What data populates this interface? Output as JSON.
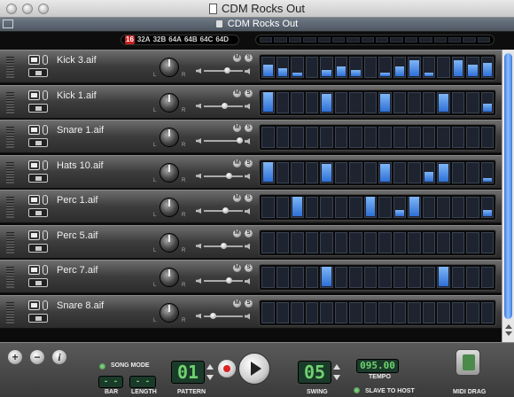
{
  "window": {
    "title": "CDM Rocks Out"
  },
  "toolbar": {
    "subtitle": "CDM Rocks Out"
  },
  "patterns": {
    "items": [
      "16",
      "32A",
      "32B",
      "64A",
      "64B",
      "64C",
      "64D"
    ],
    "active_index": 0
  },
  "tracks": [
    {
      "name": "Kick 3.aif",
      "volume": 0.62,
      "steps": [
        0.6,
        0.4,
        0.2,
        0,
        0.3,
        0.5,
        0.3,
        0,
        0.2,
        0.5,
        0.8,
        0.2,
        0,
        0.8,
        0.6,
        0.7
      ]
    },
    {
      "name": "Kick 1.aif",
      "volume": 0.54,
      "steps": [
        1,
        0,
        0,
        0,
        0.9,
        0,
        0,
        0,
        0.9,
        0,
        0,
        0,
        0.9,
        0,
        0,
        0.4
      ]
    },
    {
      "name": "Snare 1.aif",
      "volume": 1.0,
      "steps": [
        0,
        0,
        0,
        0,
        0,
        0,
        0,
        0,
        0,
        0,
        0,
        0,
        0,
        0,
        0,
        0
      ]
    },
    {
      "name": "Hats 10.aif",
      "volume": 0.68,
      "steps": [
        1,
        0,
        0,
        0,
        0.9,
        0,
        0,
        0,
        0.9,
        0,
        0,
        0.5,
        0.9,
        0,
        0,
        0.2
      ]
    },
    {
      "name": "Perc 1.aif",
      "volume": 0.58,
      "steps": [
        0,
        0,
        1,
        0,
        0,
        0,
        0,
        1,
        0,
        0.3,
        1,
        0,
        0,
        0,
        0,
        0.3
      ]
    },
    {
      "name": "Perc 5.aif",
      "volume": 0.5,
      "steps": [
        0,
        0,
        0,
        0,
        0,
        0,
        0,
        0,
        0,
        0,
        0,
        0,
        0,
        0,
        0,
        0
      ]
    },
    {
      "name": "Perc 7.aif",
      "volume": 0.68,
      "steps": [
        0,
        0,
        0,
        0,
        1,
        0,
        0,
        0,
        0,
        0,
        0,
        0,
        1,
        0,
        0,
        0
      ]
    },
    {
      "name": "Snare 8.aif",
      "volume": 0.2,
      "steps": [
        0,
        0,
        0,
        0,
        0,
        0,
        0,
        0,
        0,
        0,
        0,
        0,
        0,
        0,
        0,
        0
      ]
    }
  ],
  "transport": {
    "song_mode_label": "SONG MODE",
    "bar_label": "BAR",
    "length_label": "LENGTH",
    "pattern_label": "PATTERN",
    "pattern_value": "01",
    "swing_label": "SWING",
    "swing_value": "05",
    "tempo_label": "TEMPO",
    "tempo_value": "095.00",
    "slave_label": "SLAVE TO HOST",
    "midi_label": "MIDI DRAG"
  }
}
